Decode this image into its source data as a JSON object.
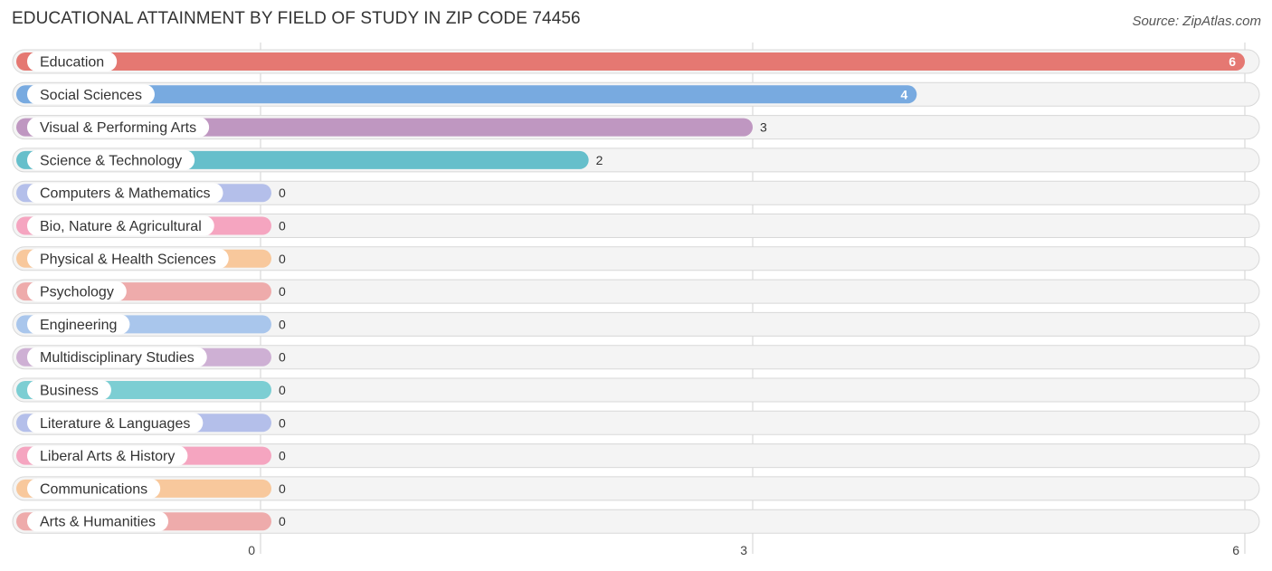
{
  "header": {
    "title": "EDUCATIONAL ATTAINMENT BY FIELD OF STUDY IN ZIP CODE 74456",
    "source": "Source: ZipAtlas.com"
  },
  "chart_data": {
    "type": "bar",
    "orientation": "horizontal",
    "title": "EDUCATIONAL ATTAINMENT BY FIELD OF STUDY IN ZIP CODE 74456",
    "xlabel": "",
    "ylabel": "",
    "xlim": [
      0,
      6
    ],
    "xticks": [
      0,
      3,
      6
    ],
    "xtick_labels": [
      "0",
      "3",
      "6"
    ],
    "grid": true,
    "legend": "none",
    "categories": [
      "Education",
      "Social Sciences",
      "Visual & Performing Arts",
      "Science & Technology",
      "Computers & Mathematics",
      "Bio, Nature & Agricultural",
      "Physical & Health Sciences",
      "Psychology",
      "Engineering",
      "Multidisciplinary Studies",
      "Business",
      "Literature & Languages",
      "Liberal Arts & History",
      "Communications",
      "Arts & Humanities"
    ],
    "values": [
      6,
      4,
      3,
      2,
      0,
      0,
      0,
      0,
      0,
      0,
      0,
      0,
      0,
      0,
      0
    ],
    "value_labels": [
      "6",
      "4",
      "3",
      "2",
      "0",
      "0",
      "0",
      "0",
      "0",
      "0",
      "0",
      "0",
      "0",
      "0",
      "0"
    ],
    "colors": [
      "#e57872",
      "#78aae0",
      "#bf97c1",
      "#66bfcb",
      "#b4bfea",
      "#f5a5c0",
      "#f8c89c",
      "#eeabab",
      "#a9c6ec",
      "#ceb0d4",
      "#7cced3",
      "#b4bfea",
      "#f5a5c0",
      "#f8c89c",
      "#eeabab"
    ]
  }
}
